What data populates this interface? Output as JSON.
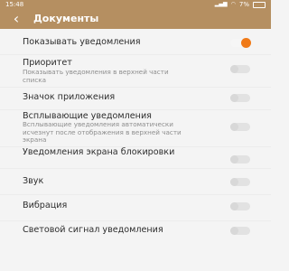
{
  "status_bar": {
    "time": "15:48",
    "battery": "7%"
  },
  "header": {
    "back_icon": "chevron-left-icon",
    "title": "Документы"
  },
  "settings": [
    {
      "label": "Показывать уведомления",
      "subtitle": "",
      "on": true
    },
    {
      "label": "Приоритет",
      "subtitle": "Показывать уведомления в верхней части списка",
      "on": false
    },
    {
      "label": "Значок приложения",
      "subtitle": "",
      "on": false
    },
    {
      "label": "Всплывающие уведомления",
      "subtitle": "Всплывающие уведомления автоматически исчезнут после отображения в верхней части экрана",
      "on": false
    },
    {
      "label": "Уведомления экрана блокировки",
      "subtitle": "",
      "on": false
    },
    {
      "label": "Звук",
      "subtitle": "",
      "on": false
    },
    {
      "label": "Вибрация",
      "subtitle": "",
      "on": false
    },
    {
      "label": "Световой сигнал уведомления",
      "subtitle": "",
      "on": false
    }
  ],
  "colors": {
    "header_bg": "#b58f61",
    "accent_on": "#f07a18"
  }
}
